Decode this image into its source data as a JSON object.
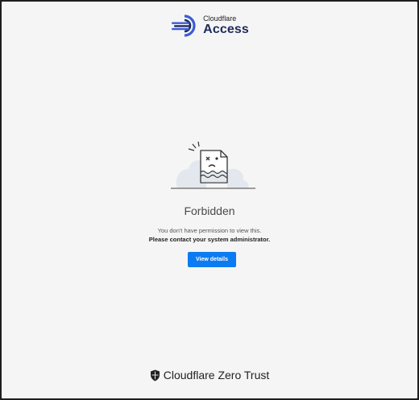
{
  "header": {
    "brand_small": "Cloudflare",
    "brand_big": "Access",
    "logo_icon": "cloudflare-access-logo-icon"
  },
  "main": {
    "illustration_icon": "sad-document-icon",
    "title": "Forbidden",
    "message": "You don't have permission to view this.",
    "message_strong": "Please contact your system administrator.",
    "details_button": "View details"
  },
  "footer": {
    "shield_icon": "shield-icon",
    "brand": "Cloudflare Zero Trust"
  },
  "colors": {
    "background": "#f5f5f5",
    "button": "#0a7bf0",
    "logo_blue": "#3b5cd8",
    "logo_navy": "#1d2b5c",
    "frame": "#1e1e1e"
  }
}
